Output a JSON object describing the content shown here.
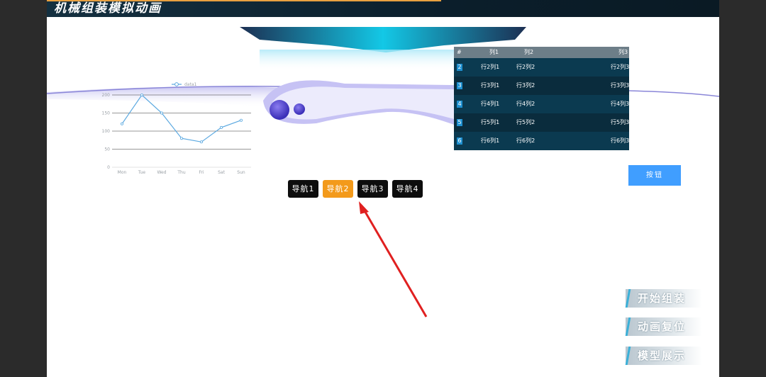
{
  "app": {
    "title": "机械组装模拟动画"
  },
  "nav": {
    "items": [
      {
        "label": "导航1",
        "active": false
      },
      {
        "label": "导航2",
        "active": true
      },
      {
        "label": "导航3",
        "active": false
      },
      {
        "label": "导航4",
        "active": false
      }
    ]
  },
  "table": {
    "headers": [
      "#",
      "列1",
      "列2",
      "列3"
    ],
    "rows": [
      [
        "2",
        "行2列1",
        "行2列2",
        "行2列3"
      ],
      [
        "3",
        "行3列1",
        "行3列2",
        "行3列3"
      ],
      [
        "4",
        "行4列1",
        "行4列2",
        "行4列3"
      ],
      [
        "5",
        "行5列1",
        "行5列2",
        "行5列3"
      ],
      [
        "6",
        "行6列1",
        "行6列2",
        "行6列3"
      ]
    ]
  },
  "action_button": {
    "label": "按钮"
  },
  "side_buttons": [
    {
      "label": "开始组装"
    },
    {
      "label": "动画复位"
    },
    {
      "label": "模型展示"
    }
  ],
  "colors": {
    "accent": "#409eff",
    "nav_active": "#f39a1b",
    "table_bg": "#0b3a50",
    "chart_line": "#5aa8e0"
  },
  "chart_data": {
    "type": "line",
    "categories": [
      "Mon",
      "Tue",
      "Wed",
      "Thu",
      "Fri",
      "Sat",
      "Sun"
    ],
    "series": [
      {
        "name": "data1",
        "values": [
          120,
          200,
          150,
          80,
          70,
          110,
          130
        ]
      }
    ],
    "yticks": [
      "0",
      "50",
      "100",
      "150",
      "200"
    ],
    "ylim": [
      0,
      200
    ],
    "legend": "top-center",
    "grid": true
  }
}
